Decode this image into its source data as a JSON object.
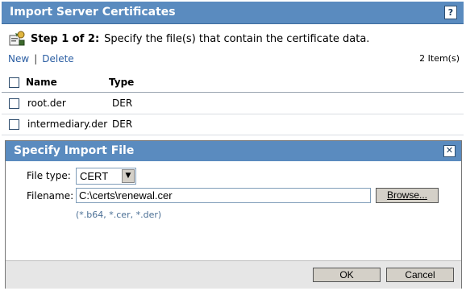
{
  "wizard": {
    "title": "Import Server Certificates",
    "help_label": "?",
    "step": {
      "label": "Step 1 of 2:",
      "text": "Specify the file(s) that contain the certificate data.",
      "icon": "certificate-wizard-icon"
    },
    "toolbar": {
      "new_label": "New",
      "separator": "|",
      "delete_label": "Delete"
    },
    "item_count": "2 Item(s)",
    "table": {
      "columns": [
        "Name",
        "Type"
      ],
      "rows": [
        {
          "name": "root.der",
          "type": "DER",
          "checked": false
        },
        {
          "name": "intermediary.der",
          "type": "DER",
          "checked": false
        }
      ]
    }
  },
  "dialog": {
    "title": "Specify Import File",
    "close_label": "✕",
    "file_type_label": "File type:",
    "file_type_value": "CERT",
    "filename_label": "Filename:",
    "filename_value": "C:\\certs\\renewal.cer",
    "browse_label": "Browse...",
    "hint": "(*.b64, *.cer, *.der)",
    "ok_label": "OK",
    "cancel_label": "Cancel"
  },
  "colors": {
    "titlebar": "#5a8bbf",
    "link": "#2b5ea3",
    "hint": "#4b6f95"
  }
}
